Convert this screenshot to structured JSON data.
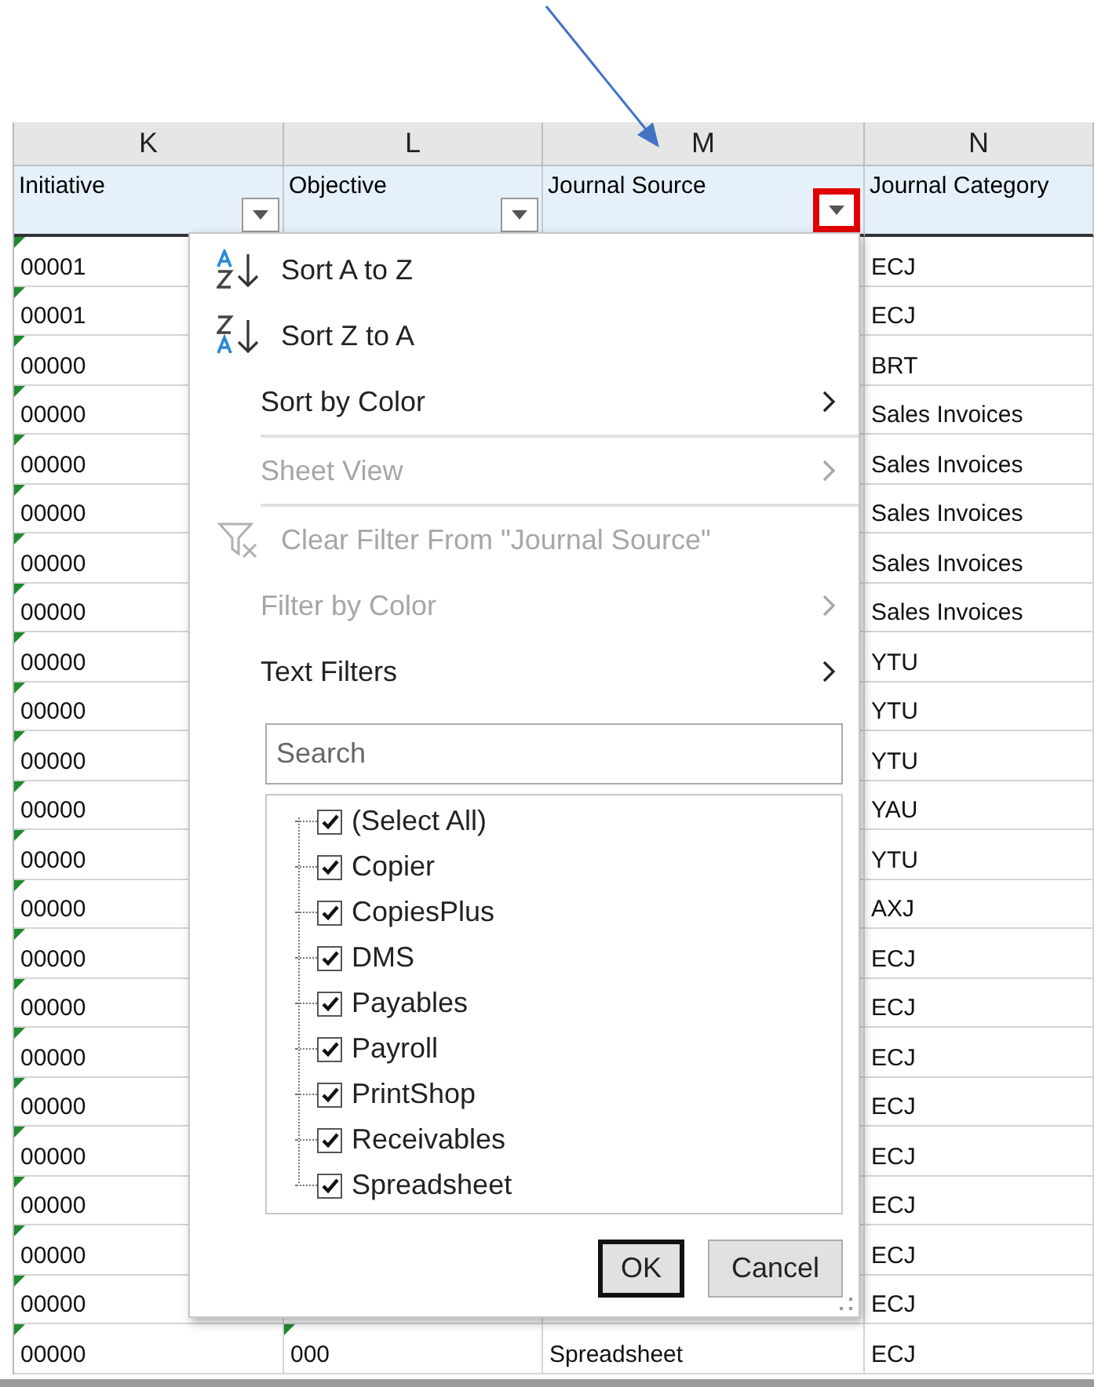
{
  "columns": [
    {
      "letter": "K",
      "header": "Initiative",
      "highlighted": false
    },
    {
      "letter": "L",
      "header": "Objective",
      "highlighted": false
    },
    {
      "letter": "M",
      "header": "Journal Source",
      "highlighted": true
    },
    {
      "letter": "N",
      "header": "Journal Category",
      "highlighted": false
    }
  ],
  "rows": [
    [
      "00001",
      "",
      "",
      "ECJ"
    ],
    [
      "00001",
      "",
      "",
      "ECJ"
    ],
    [
      "00000",
      "",
      "",
      "BRT"
    ],
    [
      "00000",
      "",
      "",
      "Sales Invoices"
    ],
    [
      "00000",
      "",
      "",
      "Sales Invoices"
    ],
    [
      "00000",
      "",
      "",
      "Sales Invoices"
    ],
    [
      "00000",
      "",
      "",
      "Sales Invoices"
    ],
    [
      "00000",
      "",
      "",
      "Sales Invoices"
    ],
    [
      "00000",
      "",
      "",
      "YTU"
    ],
    [
      "00000",
      "",
      "",
      "YTU"
    ],
    [
      "00000",
      "",
      "",
      "YTU"
    ],
    [
      "00000",
      "",
      "",
      "YAU"
    ],
    [
      "00000",
      "",
      "",
      "YTU"
    ],
    [
      "00000",
      "",
      "",
      "AXJ"
    ],
    [
      "00000",
      "",
      "",
      "ECJ"
    ],
    [
      "00000",
      "",
      "",
      "ECJ"
    ],
    [
      "00000",
      "",
      "",
      "ECJ"
    ],
    [
      "00000",
      "",
      "",
      "ECJ"
    ],
    [
      "00000",
      "",
      "",
      "ECJ"
    ],
    [
      "00000",
      "",
      "",
      "ECJ"
    ],
    [
      "00000",
      "",
      "",
      "ECJ"
    ],
    [
      "00000",
      "",
      "",
      "ECJ"
    ],
    [
      "00000",
      "000",
      "Spreadsheet",
      "ECJ"
    ]
  ],
  "filter_menu": {
    "items": [
      {
        "kind": "sort_asc",
        "label": "Sort A to Z",
        "disabled": false,
        "submenu": false
      },
      {
        "kind": "sort_desc",
        "label": "Sort Z to A",
        "disabled": false,
        "submenu": false
      },
      {
        "kind": "plain",
        "label": "Sort by Color",
        "disabled": false,
        "submenu": true
      },
      {
        "kind": "separator"
      },
      {
        "kind": "plain",
        "label": "Sheet View",
        "disabled": true,
        "submenu": true
      },
      {
        "kind": "separator"
      },
      {
        "kind": "clear",
        "label": "Clear Filter From \"Journal Source\"",
        "disabled": true,
        "submenu": false
      },
      {
        "kind": "plain",
        "label": "Filter by Color",
        "disabled": true,
        "submenu": true
      },
      {
        "kind": "plain",
        "label": "Text Filters",
        "disabled": false,
        "submenu": true
      }
    ],
    "search": {
      "placeholder": "Search"
    },
    "values": [
      {
        "label": "(Select All)",
        "checked": true
      },
      {
        "label": "Copier",
        "checked": true
      },
      {
        "label": "CopiesPlus",
        "checked": true
      },
      {
        "label": "DMS",
        "checked": true
      },
      {
        "label": "Payables",
        "checked": true
      },
      {
        "label": "Payroll",
        "checked": true
      },
      {
        "label": "PrintShop",
        "checked": true
      },
      {
        "label": "Receivables",
        "checked": true
      },
      {
        "label": "Spreadsheet",
        "checked": true
      }
    ],
    "buttons": [
      {
        "label": "OK",
        "kind": "default"
      },
      {
        "label": "Cancel",
        "kind": "normal"
      }
    ]
  }
}
